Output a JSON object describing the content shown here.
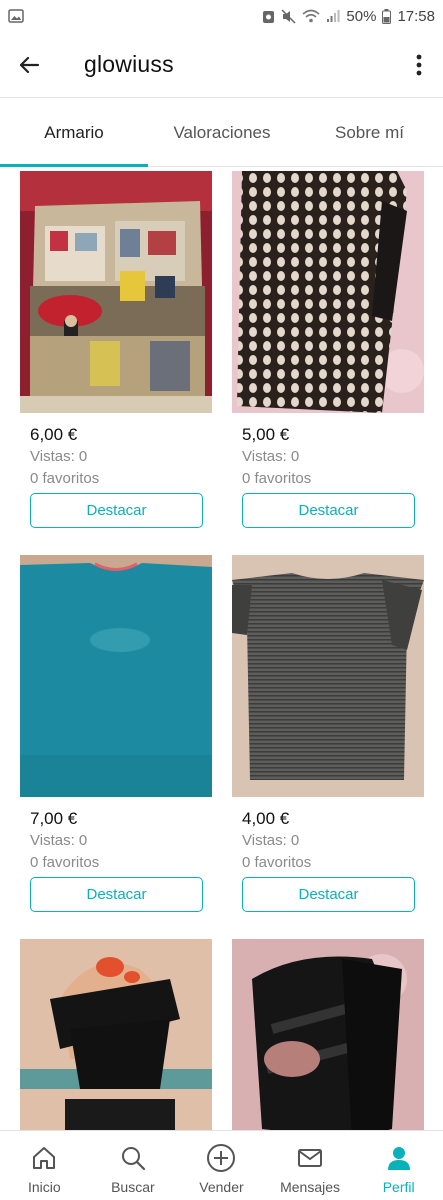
{
  "status_bar": {
    "battery": "50%",
    "time": "17:58"
  },
  "app_bar": {
    "title": "glowiuss"
  },
  "tabs": [
    {
      "label": "Armario"
    },
    {
      "label": "Valoraciones"
    },
    {
      "label": "Sobre mí"
    }
  ],
  "items": [
    {
      "price": "6,00 €",
      "views": "Vistas: 0",
      "favorites": "0 favoritos",
      "button": "Destacar"
    },
    {
      "price": "5,00 €",
      "views": "Vistas: 0",
      "favorites": "0 favoritos",
      "button": "Destacar"
    },
    {
      "price": "7,00 €",
      "views": "Vistas: 0",
      "favorites": "0 favoritos",
      "button": "Destacar"
    },
    {
      "price": "4,00 €",
      "views": "Vistas: 0",
      "favorites": "0 favoritos",
      "button": "Destacar"
    }
  ],
  "bottom_nav": [
    {
      "label": "Inicio",
      "icon": "home-icon"
    },
    {
      "label": "Buscar",
      "icon": "search-icon"
    },
    {
      "label": "Vender",
      "icon": "plus-circle-icon"
    },
    {
      "label": "Mensajes",
      "icon": "mail-icon"
    },
    {
      "label": "Perfil",
      "icon": "person-icon"
    }
  ],
  "colors": {
    "accent": "#09b1ba"
  }
}
